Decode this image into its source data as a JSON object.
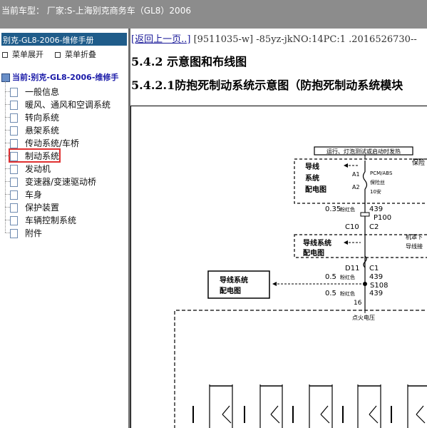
{
  "topbar": {
    "text": "当前车型：  厂家:S-上海别克商务车（GL8）2006"
  },
  "sidebar": {
    "title": "别克-GL8-2006-维修手册",
    "expand_label": "菜单展开",
    "collapse_label": "菜单折叠",
    "current_label": "当前:别克-GL8-2006-维修手",
    "items": [
      {
        "label": "一般信息"
      },
      {
        "label": "暖风、通风和空调系统"
      },
      {
        "label": "转向系统"
      },
      {
        "label": "悬架系统"
      },
      {
        "label": "传动系统/车桥"
      },
      {
        "label": "制动系统",
        "selected": true
      },
      {
        "label": "发动机"
      },
      {
        "label": "变速器/变速驱动桥"
      },
      {
        "label": "车身"
      },
      {
        "label": "保护装置"
      },
      {
        "label": "车辆控制系统"
      },
      {
        "label": "附件"
      }
    ]
  },
  "content": {
    "back_link": "[返回上一页..]",
    "doc_id": "[9511035-w] -85yz-jkNO:14PC:1 .2016526730--",
    "heading1": "5.4.2 示意图和布线图",
    "heading2": "5.4.2.1防抱死制动系统示意图（防抱死制动系统模块"
  },
  "diagram": {
    "banner": "运行、灯泡测试或启动时发热",
    "box1_label_line1": "导线",
    "box1_label_line2": "系统",
    "box1_label_line3": "配电图",
    "pin_a1": "A1",
    "pin_a2": "A2",
    "fuse_line1": "PCM/ABS",
    "fuse_line2": "保险丝",
    "fuse_line3": "10安",
    "right_note1": "保险",
    "wire1_gauge": "0.35",
    "wire1_color": "粉红色",
    "wire1_code": "439",
    "conn_p100": "P100",
    "conn_c10": "C10",
    "conn_c2": "C2",
    "box2_line1": "导线系统",
    "box2_line2": "配电图",
    "right_note2a": "机罩下",
    "right_note2b": "导线接",
    "conn_d11": "D11",
    "conn_c1": "C1",
    "wire2_gauge": "0.5",
    "wire2_color": "粉红色",
    "wire2_code": "439",
    "box3_line1": "导线系统",
    "box3_line2": "配电图",
    "splice": "S108",
    "wire3_gauge": "0.5",
    "wire3_color": "粉红色",
    "wire3_code": "439",
    "pin_16": "16",
    "ignition": "点火电压"
  }
}
